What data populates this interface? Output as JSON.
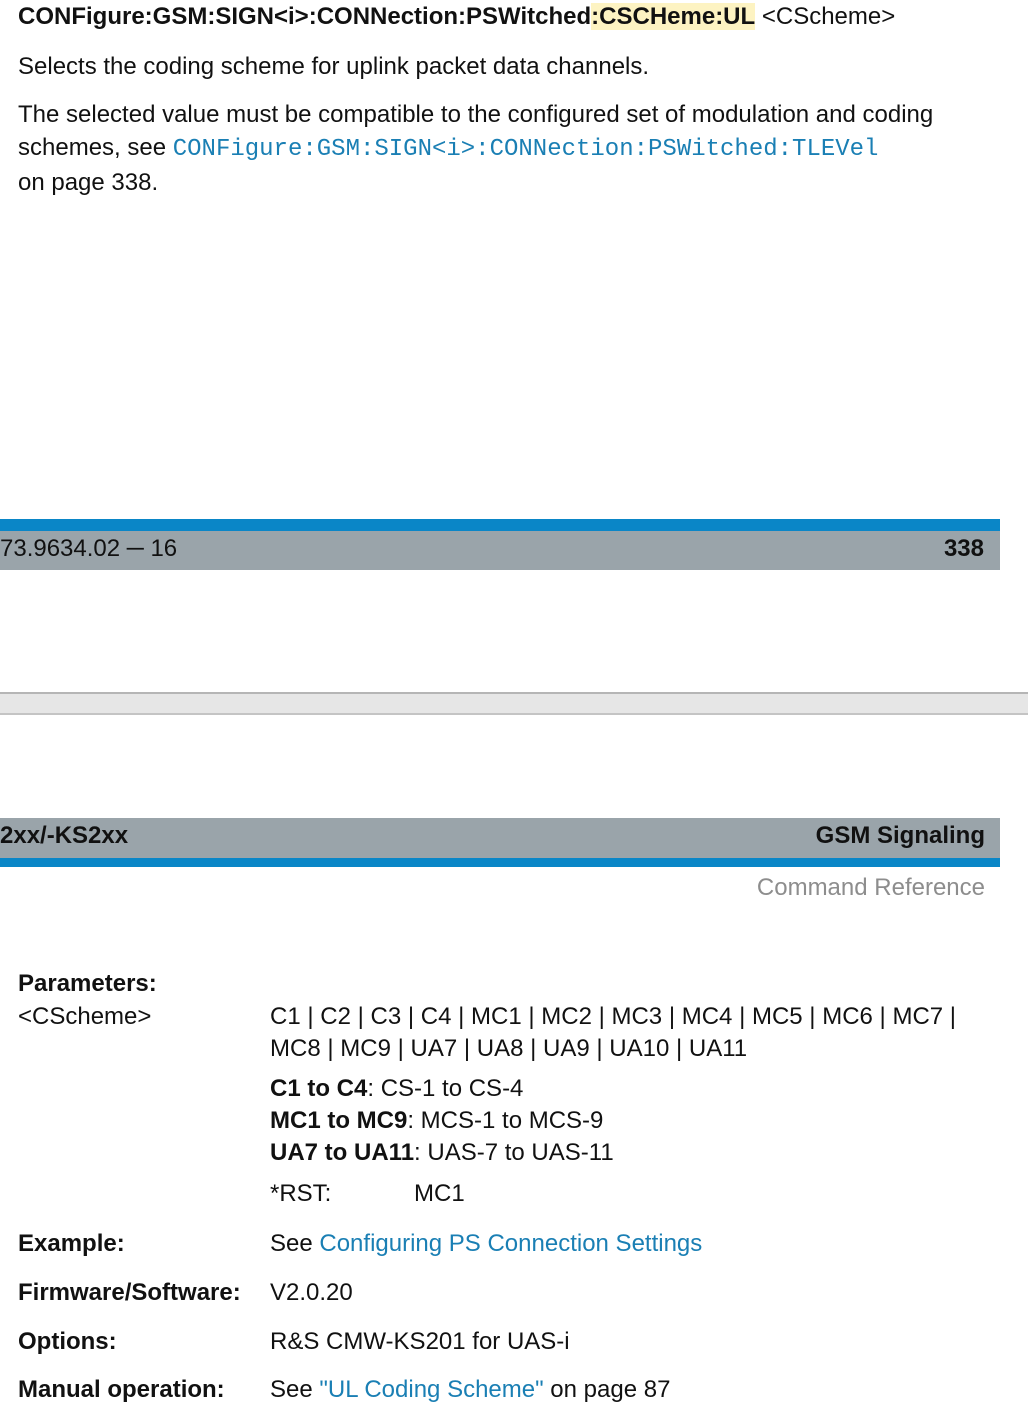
{
  "command": {
    "prefix": "CONFigure:GSM:SIGN<i>:CONNection:PSWitched",
    "highlight": ":CSCHeme:UL",
    "param": " <CScheme>"
  },
  "description": "Selects the coding scheme for uplink packet data channels.",
  "note": {
    "line1": "The selected value must be compatible to the configured set of modulation and coding",
    "line2_prefix": "schemes, see ",
    "link": "CONFigure:GSM:SIGN<i>:CONNection:PSWitched:TLEVel",
    "line3": "on page 338."
  },
  "footer": {
    "doc_number": "73.9634.02 ─ 16",
    "page": "338"
  },
  "header": {
    "left": "2xx/-KS2xx",
    "right": "GSM Signaling",
    "sub": "Command Reference"
  },
  "parameters": {
    "heading": "Parameters:",
    "name": "<CScheme>",
    "values_line1": "C1 | C2 | C3 | C4 | MC1 | MC2 | MC3 | MC4 | MC5 | MC6 | MC7 |",
    "values_line2": "MC8 | MC9 | UA7 | UA8 | UA9 | UA10 | UA11",
    "defs": [
      {
        "term": "C1 to C4",
        "desc": ": CS-1 to CS-4"
      },
      {
        "term": "MC1 to MC9",
        "desc": ": MCS-1 to MCS-9"
      },
      {
        "term": "UA7 to UA11",
        "desc": ": UAS-7 to UAS-11"
      }
    ],
    "rst_label": "*RST:",
    "rst_value": "MC1"
  },
  "example": {
    "label": "Example:",
    "prefix": "See ",
    "link": "Configuring PS Connection Settings"
  },
  "firmware": {
    "label": "Firmware/Software:",
    "value": "V2.0.20"
  },
  "options": {
    "label": "Options:",
    "value": "R&S CMW-KS201 for UAS-i"
  },
  "manual": {
    "label": "Manual operation:",
    "prefix": "See ",
    "link": "\"UL Coding Scheme\"",
    "suffix": " on page 87"
  }
}
